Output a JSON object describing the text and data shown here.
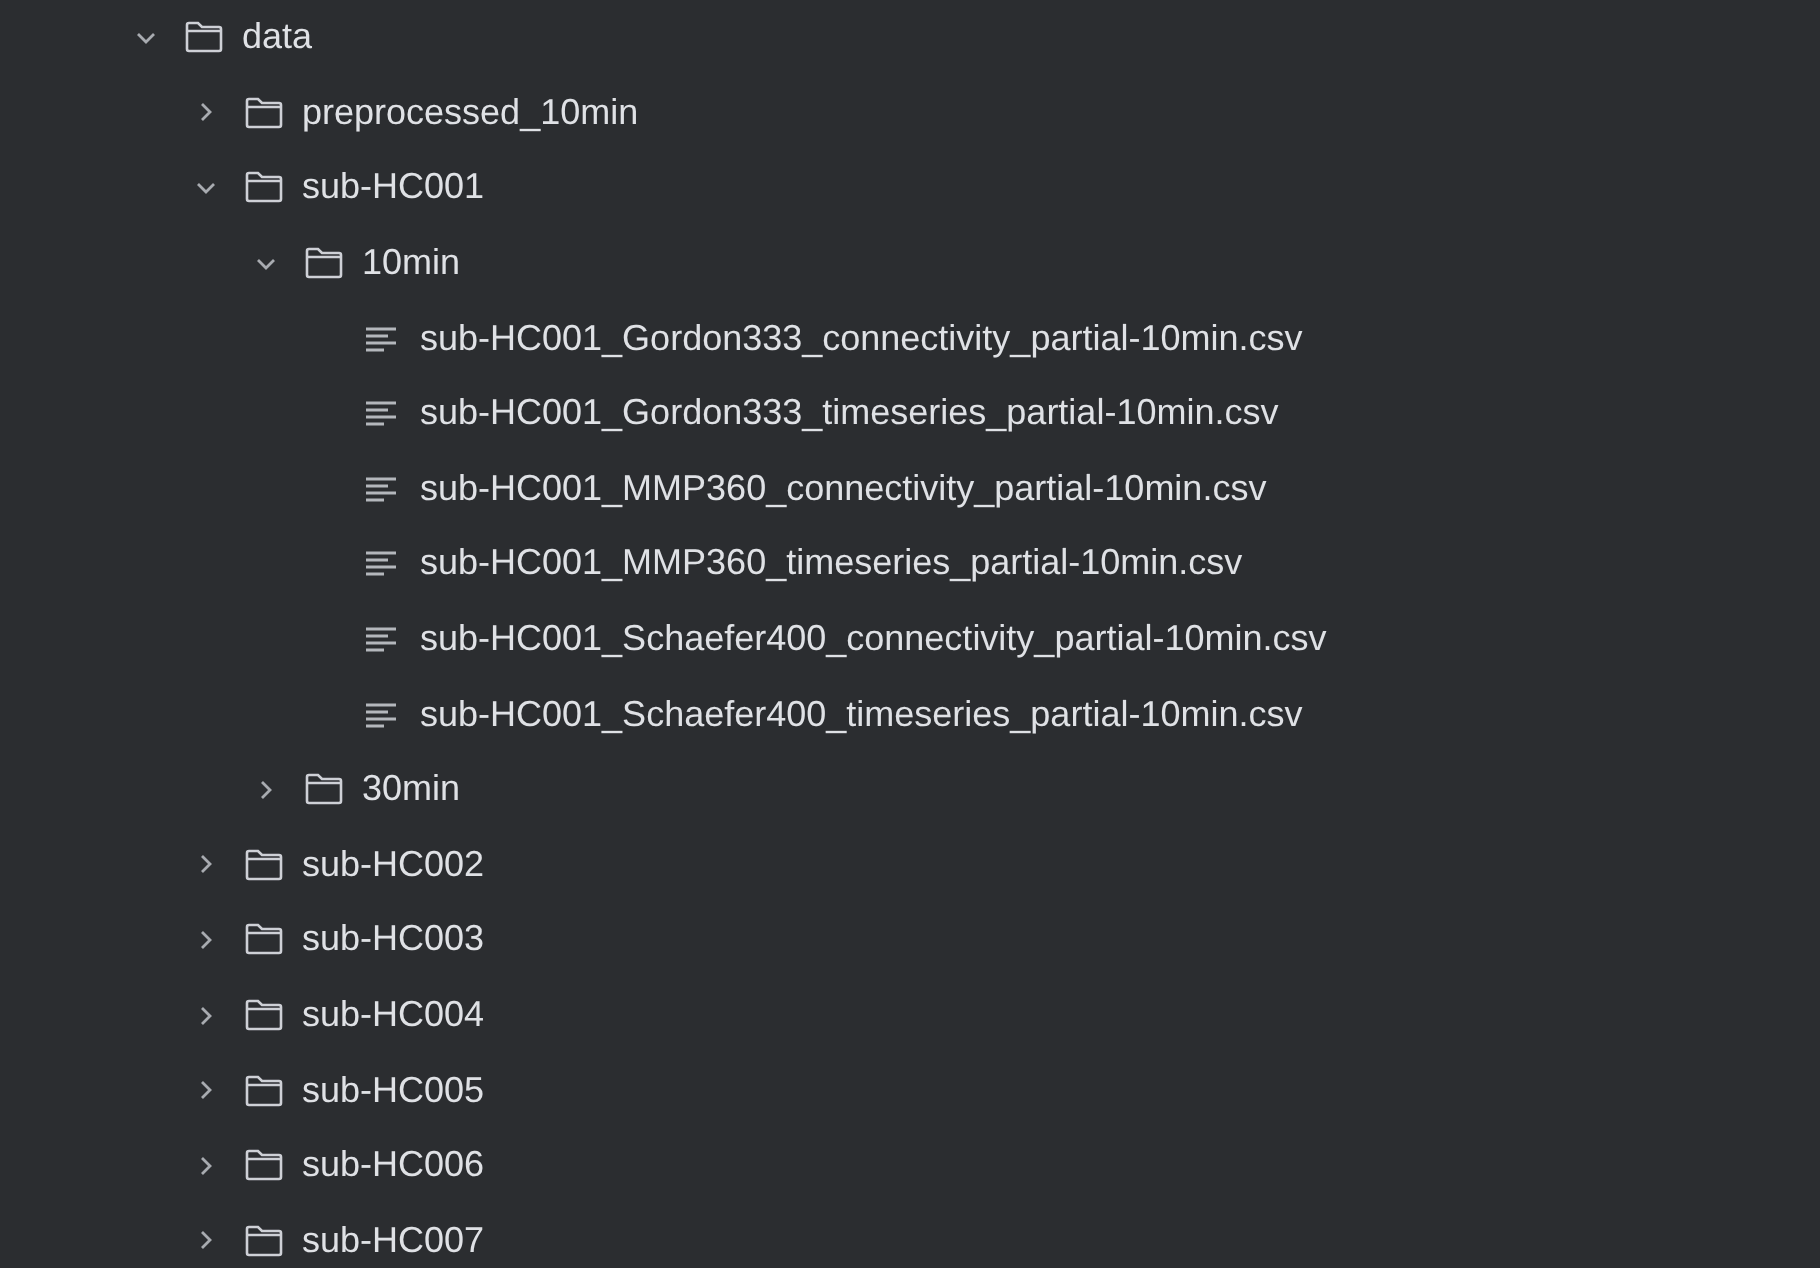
{
  "tree": [
    {
      "kind": "folder",
      "label": "data",
      "expanded": true,
      "children": [
        {
          "kind": "folder",
          "label": "preprocessed_10min",
          "expanded": false
        },
        {
          "kind": "folder",
          "label": "sub-HC001",
          "expanded": true,
          "children": [
            {
              "kind": "folder",
              "label": "10min",
              "expanded": true,
              "children": [
                {
                  "kind": "file",
                  "label": "sub-HC001_Gordon333_connectivity_partial-10min.csv"
                },
                {
                  "kind": "file",
                  "label": "sub-HC001_Gordon333_timeseries_partial-10min.csv"
                },
                {
                  "kind": "file",
                  "label": "sub-HC001_MMP360_connectivity_partial-10min.csv"
                },
                {
                  "kind": "file",
                  "label": "sub-HC001_MMP360_timeseries_partial-10min.csv"
                },
                {
                  "kind": "file",
                  "label": "sub-HC001_Schaefer400_connectivity_partial-10min.csv"
                },
                {
                  "kind": "file",
                  "label": "sub-HC001_Schaefer400_timeseries_partial-10min.csv"
                }
              ]
            },
            {
              "kind": "folder",
              "label": "30min",
              "expanded": false
            }
          ]
        },
        {
          "kind": "folder",
          "label": "sub-HC002",
          "expanded": false
        },
        {
          "kind": "folder",
          "label": "sub-HC003",
          "expanded": false
        },
        {
          "kind": "folder",
          "label": "sub-HC004",
          "expanded": false
        },
        {
          "kind": "folder",
          "label": "sub-HC005",
          "expanded": false
        },
        {
          "kind": "folder",
          "label": "sub-HC006",
          "expanded": false
        },
        {
          "kind": "folder",
          "label": "sub-HC007",
          "expanded": false
        }
      ]
    }
  ]
}
